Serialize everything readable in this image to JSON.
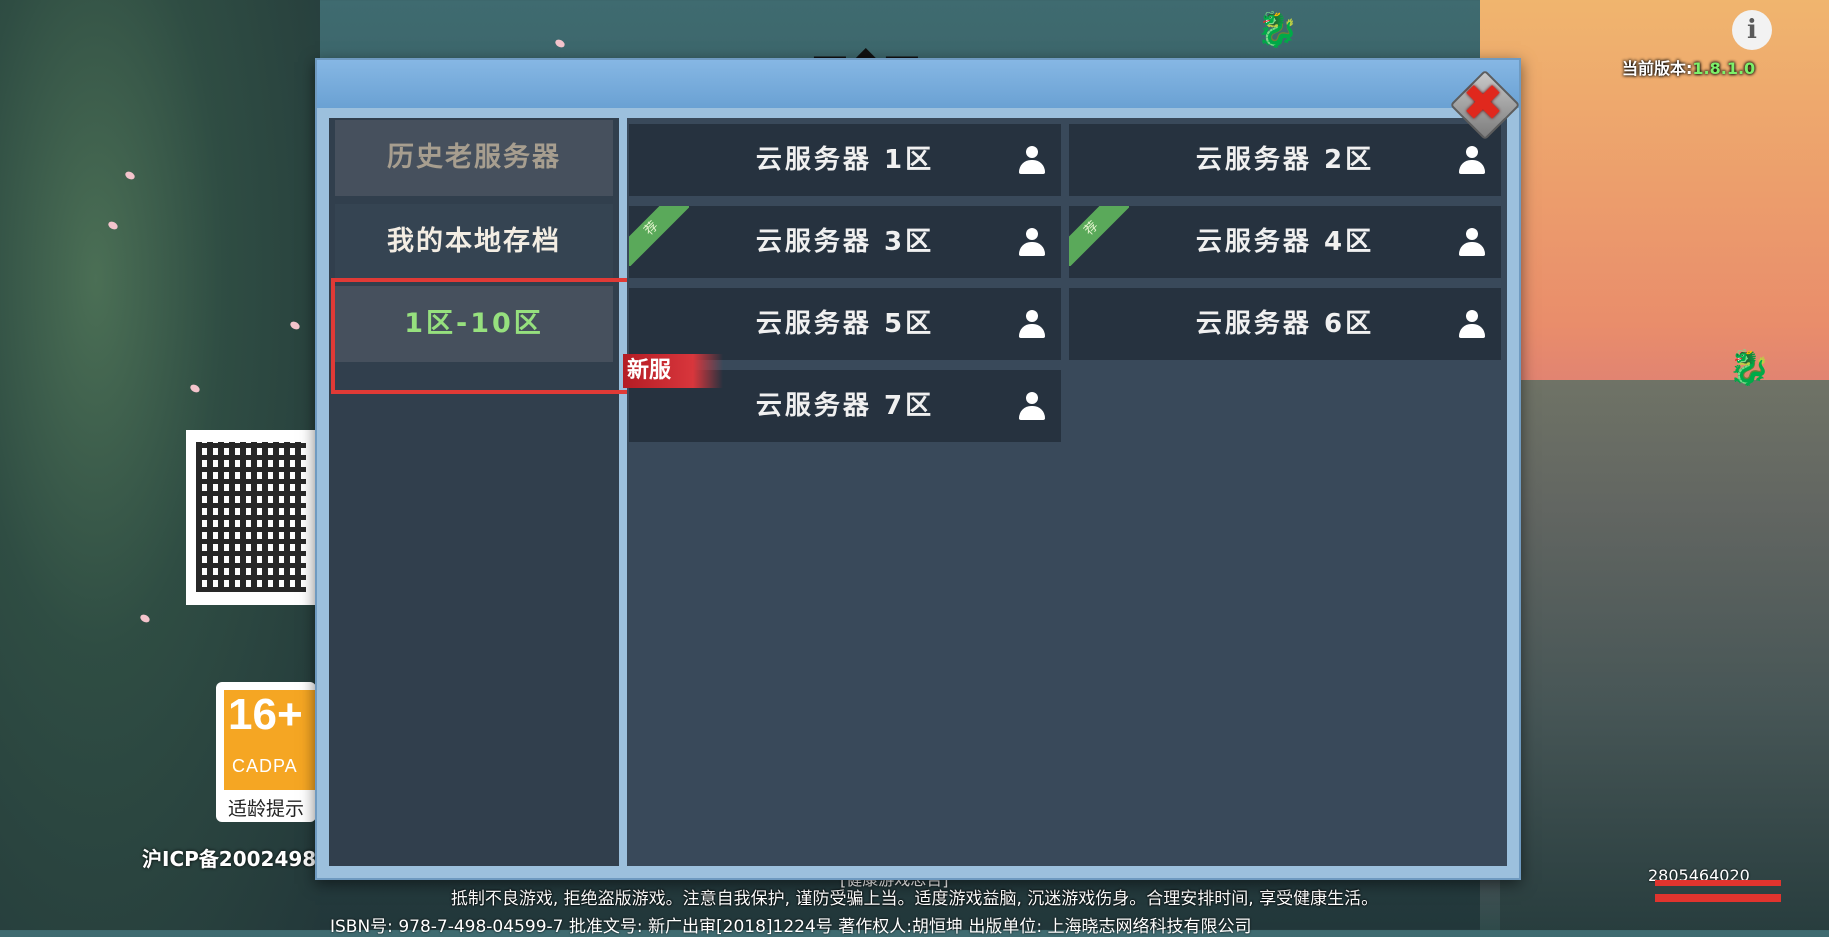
{
  "version": {
    "label": "当前版本:",
    "value": "1.8.1.0"
  },
  "info_icon": "i",
  "dialog": {
    "close_icon": "✖",
    "sidebar": {
      "items": [
        {
          "label": "历史老服务器"
        },
        {
          "label": "我的本地存档"
        },
        {
          "label": "1区-10区"
        }
      ]
    },
    "servers": [
      {
        "name": "云服务器 1区"
      },
      {
        "name": "云服务器 2区"
      },
      {
        "name": "云服务器 3区",
        "badge": "荐"
      },
      {
        "name": "云服务器 4区",
        "badge": "荐"
      },
      {
        "name": "云服务器 5区"
      },
      {
        "name": "云服务器 6区"
      },
      {
        "name": "云服务器 7区",
        "badge": "新服"
      }
    ]
  },
  "age_rating": {
    "age": "16+",
    "org": "CADPA",
    "tip": "适龄提示"
  },
  "icp": "沪ICP备2002498",
  "footer": {
    "game_tag": "[健康游戏忠告]",
    "notice": "抵制不良游戏, 拒绝盗版游戏。注意自我保护, 谨防受骗上当。适度游戏益脑, 沉迷游戏伤身。合理安排时间, 享受健康生活。",
    "isbn": "ISBN号: 978-7-498-04599-7  批准文号: 新广出审[2018]1224号  著作权人:胡恒坤  出版单位: 上海晓志网络科技有限公司",
    "uid": "2805464020"
  },
  "colors": {
    "accent_green": "#96e07e",
    "highlight_red": "#e03a36",
    "recommend_green": "#5aa95a"
  }
}
